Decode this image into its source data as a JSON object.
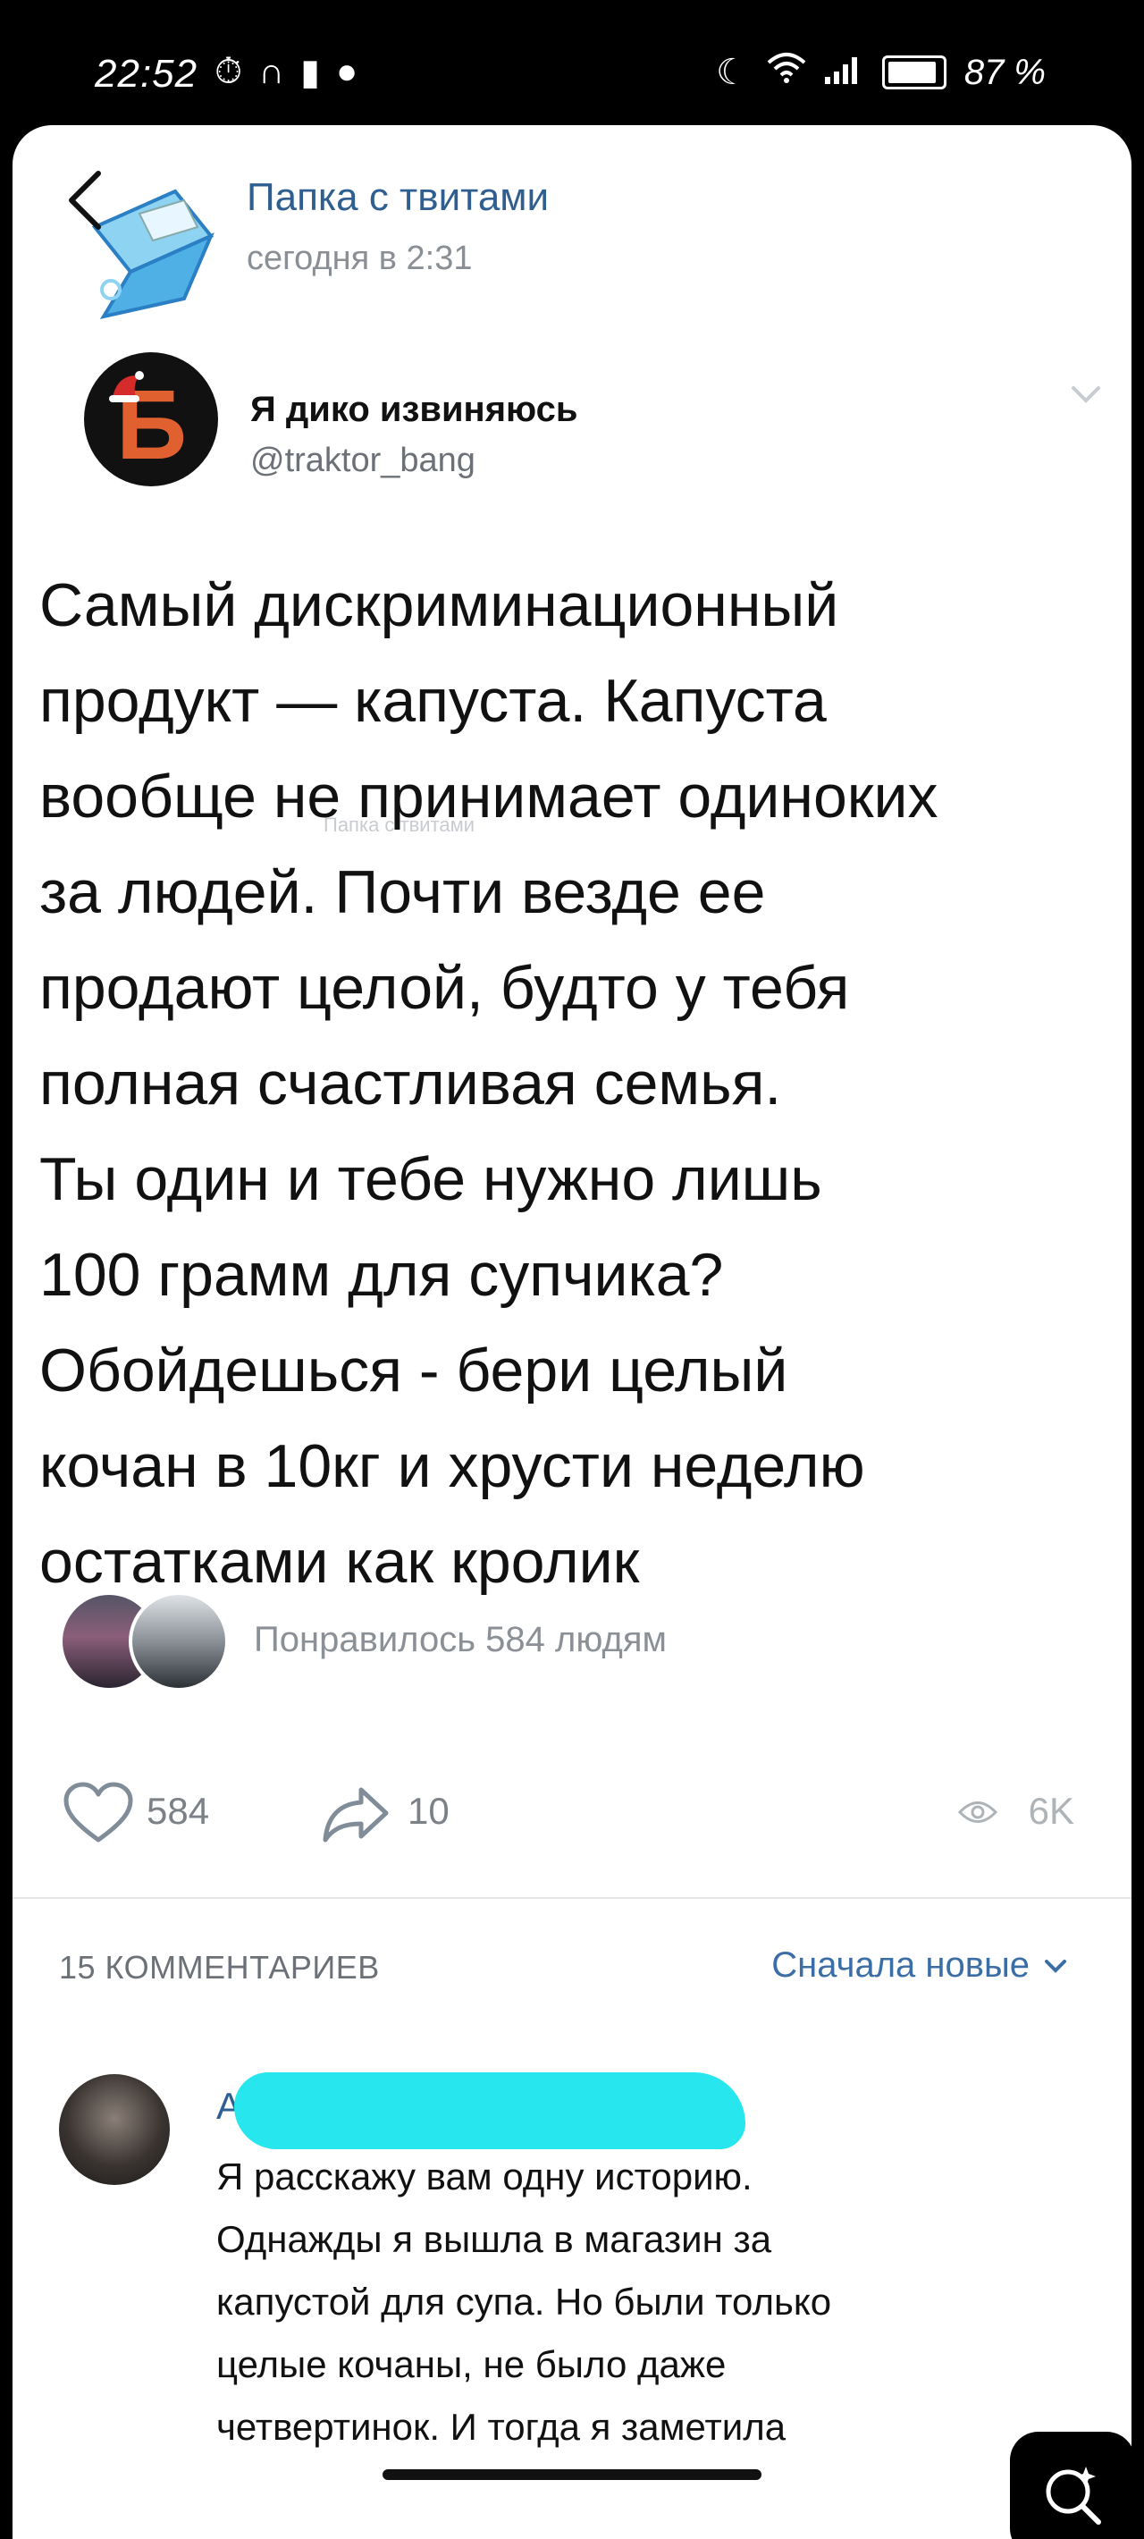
{
  "status_bar": {
    "time": "22:52",
    "left_icons": [
      "alarm-icon",
      "headphones-icon",
      "battery-saver-icon",
      "chat-icon"
    ],
    "right_icons": [
      "moon-icon",
      "wifi-icon",
      "signal-icon",
      "battery-icon"
    ],
    "battery_percent": "87 %"
  },
  "post": {
    "group_name": "Папка с твитами",
    "time": "сегодня в 2:31"
  },
  "tweet": {
    "author": "Я дико извиняюсь",
    "handle": "@traktor_bang",
    "avatar_letter": "Б",
    "lines": [
      "Самый дискриминационный",
      "продукт — капуста. Капуста",
      "вообще не принимает одиноких",
      "за людей. Почти везде ее",
      "продают целой, будто у тебя",
      "полная счастливая семья.",
      "Ты один и тебе нужно лишь",
      "100 грамм для супчика?",
      "Обойдешься - бери целый",
      "кочан в 10кг и хрусти неделю",
      "остатками как кролик"
    ],
    "watermark": "Папка с твитами"
  },
  "likes": {
    "text": "Понравилось 584 людям"
  },
  "actions": {
    "likes": "584",
    "shares": "10",
    "views": "6K"
  },
  "comments": {
    "count_label": "15 КОММЕНТАРИЕВ",
    "sort_label": "Сначала новые",
    "items": [
      {
        "author_initial": "А",
        "lines": [
          "Я расскажу вам одну историю.",
          "Однажды я вышла в магазин за",
          "капустой для супа. Но были только",
          "целые кочаны, не было даже",
          "четвертинок. И тогда я заметила"
        ]
      }
    ]
  },
  "colors": {
    "link": "#2f5f91",
    "accent": "#3b6ea5",
    "redaction": "#27e6ee"
  }
}
